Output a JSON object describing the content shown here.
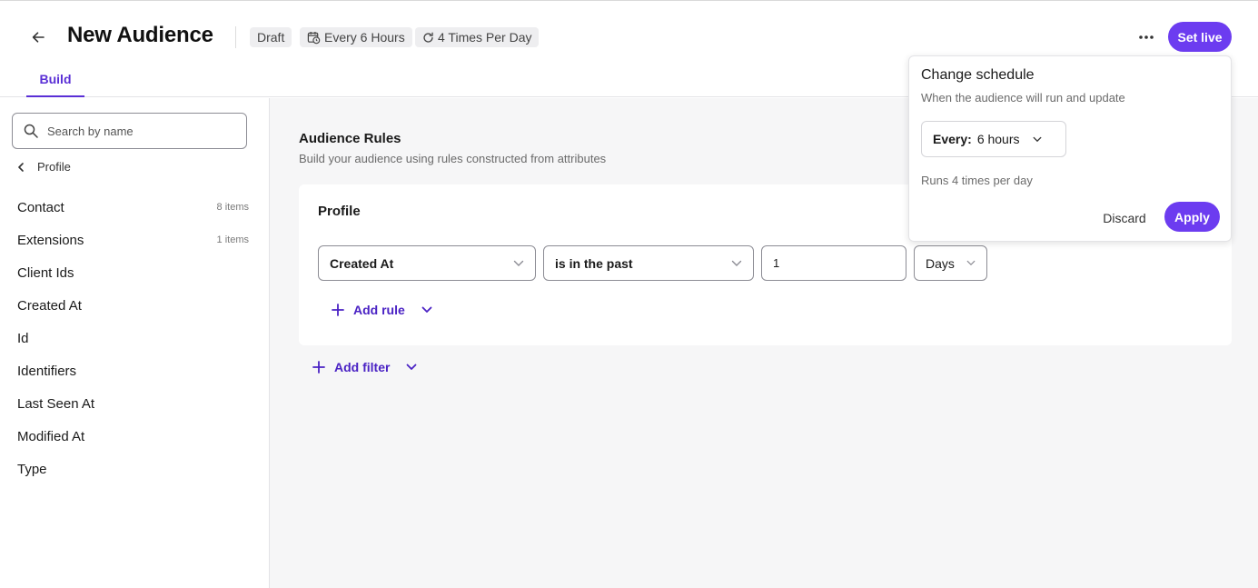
{
  "header": {
    "title": "New Audience",
    "status_chip": "Draft",
    "schedule_chip": "Every 6 Hours",
    "frequency_chip": "4 Times Per Day",
    "set_live_label": "Set live"
  },
  "tabs": [
    {
      "label": "Build",
      "active": true
    }
  ],
  "sidebar": {
    "search_placeholder": "Search by name",
    "breadcrumb": "Profile",
    "items": [
      {
        "label": "Contact",
        "count": "8 items"
      },
      {
        "label": "Extensions",
        "count": "1 items"
      },
      {
        "label": "Client Ids",
        "count": ""
      },
      {
        "label": "Created At",
        "count": ""
      },
      {
        "label": "Id",
        "count": ""
      },
      {
        "label": "Identifiers",
        "count": ""
      },
      {
        "label": "Last Seen At",
        "count": ""
      },
      {
        "label": "Modified At",
        "count": ""
      },
      {
        "label": "Type",
        "count": ""
      }
    ]
  },
  "main": {
    "section_title": "Audience Rules",
    "section_subtitle": "Build your audience using rules constructed from attributes",
    "card": {
      "title": "Profile",
      "rule": {
        "attribute": "Created At",
        "operator": "is in the past",
        "value": "1",
        "unit": "Days"
      },
      "add_rule_label": "Add rule"
    },
    "add_filter_label": "Add filter"
  },
  "popover": {
    "title": "Change schedule",
    "subtitle": "When the audience will run and update",
    "select_key": "Every:",
    "select_value": "6 hours",
    "runs_text": "Runs 4 times per day",
    "discard_label": "Discard",
    "apply_label": "Apply"
  },
  "colors": {
    "accent": "#6c3cf0",
    "accent_text": "#4a22c4",
    "main_bg": "#f6f6f7",
    "chip_bg": "#eeeef0"
  }
}
